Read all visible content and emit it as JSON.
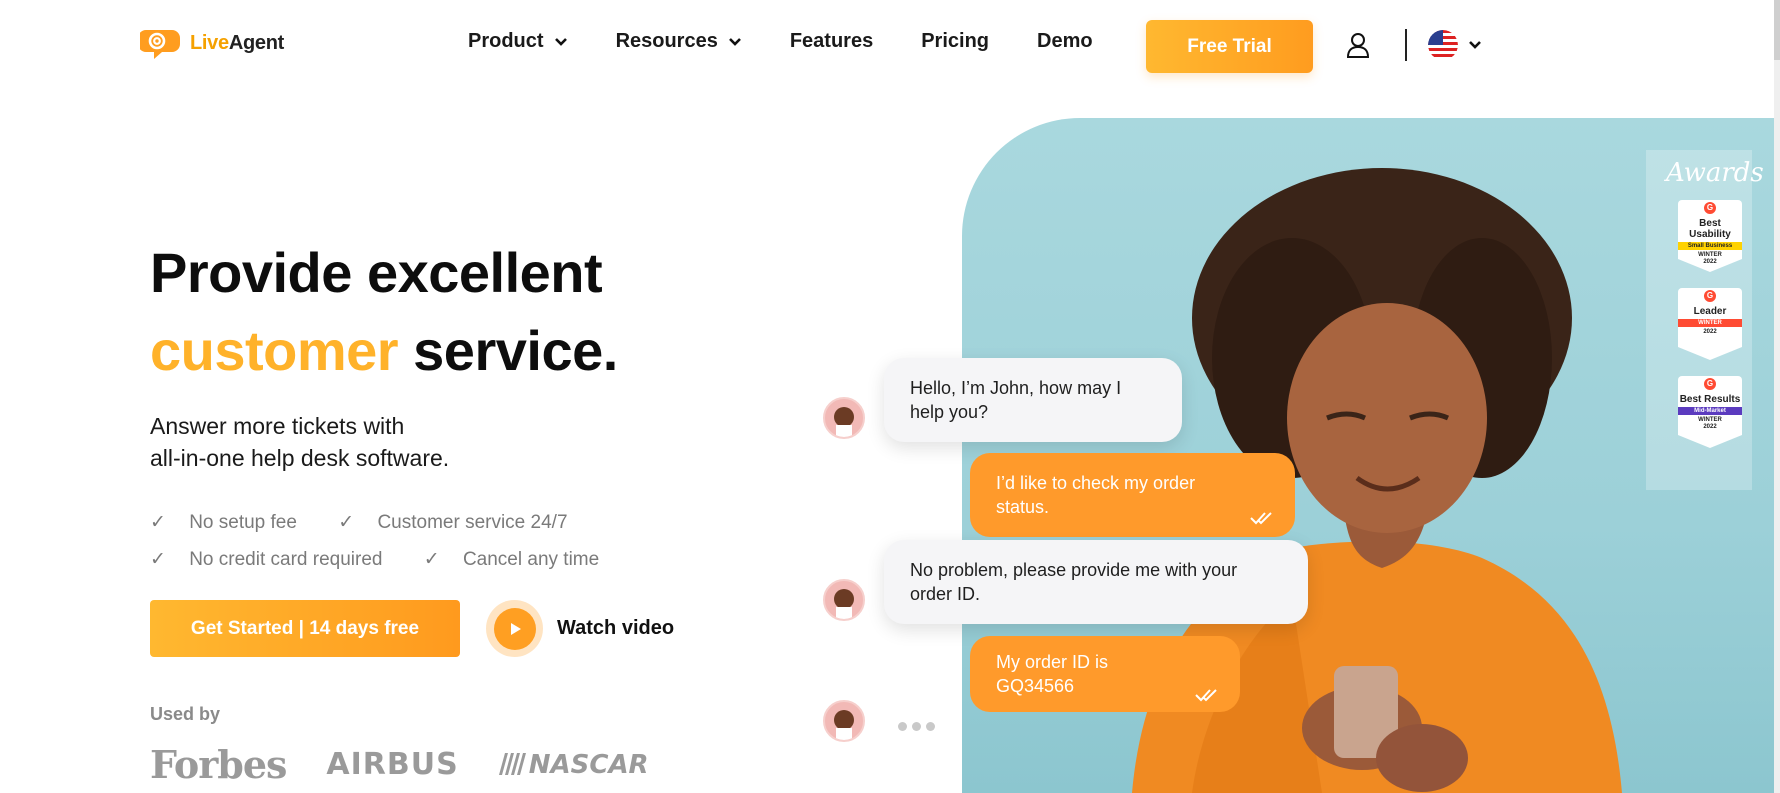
{
  "header": {
    "logo_text_live": "Live",
    "logo_text_agent": "Agent",
    "nav": [
      {
        "label": "Product",
        "has_dropdown": true
      },
      {
        "label": "Resources",
        "has_dropdown": true
      },
      {
        "label": "Features",
        "has_dropdown": false
      },
      {
        "label": "Pricing",
        "has_dropdown": false
      },
      {
        "label": "Demo",
        "has_dropdown": false
      }
    ],
    "cta_label": "Free Trial",
    "user_icon": "user-icon",
    "language_icon": "us-flag-icon"
  },
  "hero": {
    "headline_line1": "Provide excellent",
    "headline_accent": "customer",
    "headline_rest": "service.",
    "sub_line1": "Answer more tickets with",
    "sub_line2": "all-in-one help desk software.",
    "checks": [
      "No setup fee",
      "Customer service 24/7",
      "No credit card required",
      "Cancel any time"
    ],
    "check_mark": "✓",
    "primary_button": "Get Started | 14 days free",
    "watch_label": "Watch video",
    "used_by_label": "Used by",
    "brands": [
      "Forbes",
      "AIRBUS",
      "NASCAR"
    ]
  },
  "chat": {
    "messages": [
      {
        "from": "agent",
        "text": "Hello, I’m John, how may I help you?"
      },
      {
        "from": "user",
        "text": "I’d like to check my order status."
      },
      {
        "from": "agent",
        "text": "No problem, please provide me with your order ID."
      },
      {
        "from": "user",
        "text": "My order ID is GQ34566"
      }
    ]
  },
  "awards": {
    "title": "Awards",
    "badges": [
      {
        "title": "Best Usability",
        "stripe": "Small Business",
        "season": "WINTER",
        "year": "2022",
        "stripe_color": "#ffd200"
      },
      {
        "title": "Leader",
        "stripe": "WINTER",
        "season": "",
        "year": "2022",
        "stripe_color": "#ff4b33"
      },
      {
        "title": "Best Results",
        "stripe": "Mid-Market",
        "season": "WINTER",
        "year": "2022",
        "stripe_color": "#5b3bbf"
      }
    ]
  },
  "colors": {
    "accent": "#ffb22a",
    "cta": "#ff9c1f",
    "teal_bg": "#a9d8de"
  }
}
